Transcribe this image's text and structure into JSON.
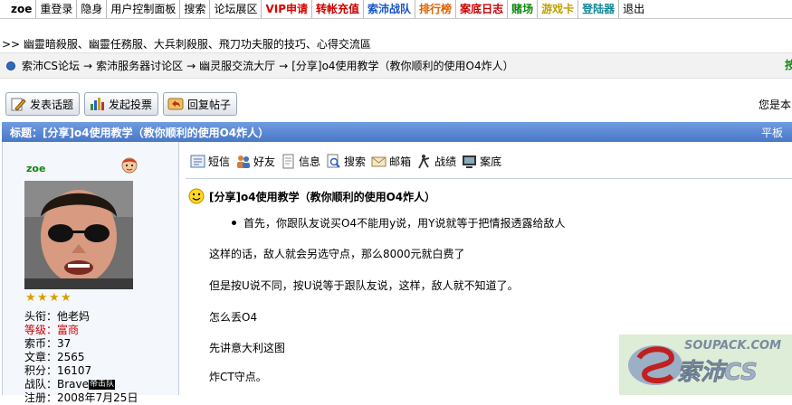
{
  "topnav": {
    "username": "zoe",
    "items": [
      {
        "label": "重登录",
        "color": "#000000"
      },
      {
        "label": "隐身",
        "color": "#000000"
      },
      {
        "label": "用户控制面板",
        "color": "#000000"
      },
      {
        "label": "搜索",
        "color": "#000000"
      },
      {
        "label": "论坛展区",
        "color": "#000000"
      },
      {
        "label": "VIP申请",
        "color": "#dd0000"
      },
      {
        "label": "转帐充值",
        "color": "#cc0000"
      },
      {
        "label": "索沛战队",
        "color": "#1a55c8"
      },
      {
        "label": "排行榜",
        "color": "#e06000"
      },
      {
        "label": "案底日志",
        "color": "#cc0000"
      },
      {
        "label": "赌场",
        "color": "#118811"
      },
      {
        "label": "游戏卡",
        "color": "#c0a000"
      },
      {
        "label": "登陆器",
        "color": "#118899"
      },
      {
        "label": "退出",
        "color": "#000000"
      }
    ]
  },
  "intro": ">> 幽靈暗殺服、幽靈任務服、大兵刺殺服、飛刀功夫服的技巧、心得交流區",
  "breadcrumb": {
    "items": [
      "索沛CS论坛",
      "索沛服务器讨论区",
      "幽灵服交流大厅",
      "[分享]o4使用教学（教你顺利的使用O4炸人）"
    ],
    "separator": "→",
    "right": "按"
  },
  "actions": {
    "new_topic": "发表话题",
    "new_poll": "发起投票",
    "reply": "回复帖子"
  },
  "right_note": "您是本!",
  "thread": {
    "title": "标题：[分享]o4使用教学（教你顺利的使用O4炸人）",
    "view_mode": "平板"
  },
  "user": {
    "name": "zoe",
    "rating_stars": 4,
    "title_label": "头衔：",
    "title_value": "他老妈",
    "level_label": "等级：",
    "level_value": "富商",
    "coins_label": "索币：",
    "coins_value": "37",
    "posts_label": "文章：",
    "posts_value": "2565",
    "points_label": "积分：",
    "points_value": "16107",
    "team_label": "战队：",
    "team_value": "Brave",
    "team_badge": "帝击队",
    "register_partial": "注册：2008年7月25日"
  },
  "post_tools": [
    "短信",
    "好友",
    "信息",
    "搜索",
    "邮箱",
    "战绩",
    "案底"
  ],
  "post": {
    "title": "[分享]o4使用教学（教你顺利的使用O4炸人）",
    "bullet": "首先，你跟队友说买O4不能用y说，用Y说就等于把情报透露给敌人",
    "paragraphs": [
      "这样的话，敌人就会另选守点，那么8000元就白费了",
      "但是按U说不同，按U说等于跟队友说，这样，敌人就不知道了。",
      "怎么丢O4",
      "先讲意大利这图",
      "炸CT守点。"
    ]
  },
  "watermark": {
    "top_text": "SOUPACK.COM",
    "bottom_text": "索沛CS"
  }
}
